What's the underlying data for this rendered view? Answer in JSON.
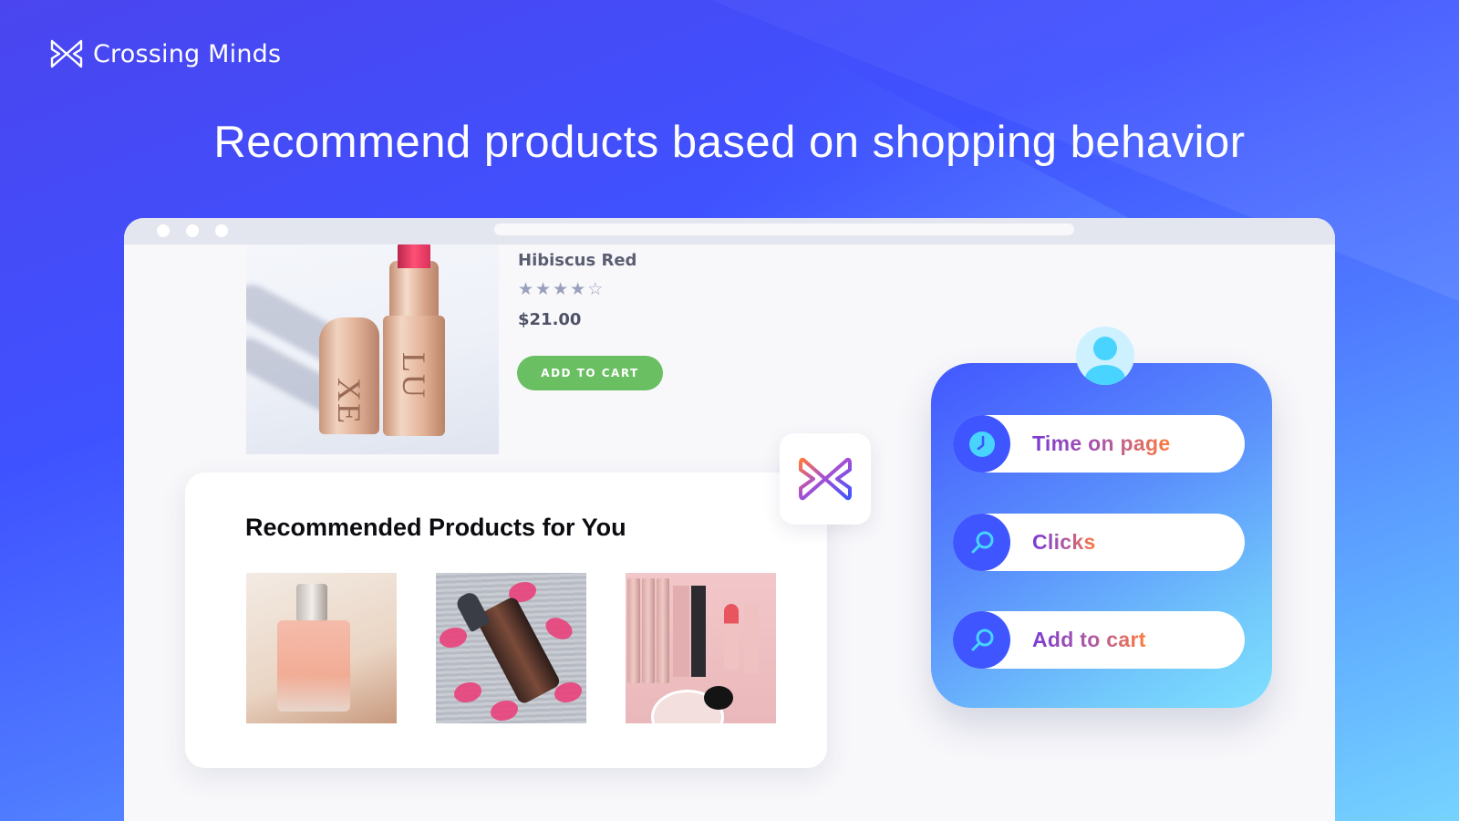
{
  "brand": {
    "name": "Crossing Minds",
    "logo_icon": "crossing-minds-butterfly-icon"
  },
  "headline": "Recommend products based on shopping behavior",
  "browser": {
    "window_dots": 3
  },
  "product": {
    "image": "lipstick-photo",
    "name": "Hibiscus Red",
    "rating": 4,
    "rating_max": 5,
    "stars": [
      "★",
      "★",
      "★",
      "★",
      "☆"
    ],
    "price": "$21.00",
    "add_to_cart_label": "ADD TO CART",
    "engraving_left": "XE",
    "engraving_right": "LU",
    "accent_color": "#6abf63"
  },
  "recommendations": {
    "title": "Recommended Products for You",
    "items": [
      {
        "image": "perfume-bottle-photo"
      },
      {
        "image": "serum-dropper-bottle-photo"
      },
      {
        "image": "pink-makeup-set-photo"
      }
    ]
  },
  "behavior_panel": {
    "avatar_icon": "user-avatar-icon",
    "signals": [
      {
        "label": "Time on page",
        "icon": "clock-icon"
      },
      {
        "label": "Clicks",
        "icon": "search-icon"
      },
      {
        "label": "Add to cart",
        "icon": "search-icon"
      }
    ],
    "colors": {
      "icon_circle": "#3e55ff",
      "icon_glyph": "#48d4ff",
      "label_gradient_start": "#7a3bd4",
      "label_gradient_end": "#ff7a3a"
    }
  }
}
